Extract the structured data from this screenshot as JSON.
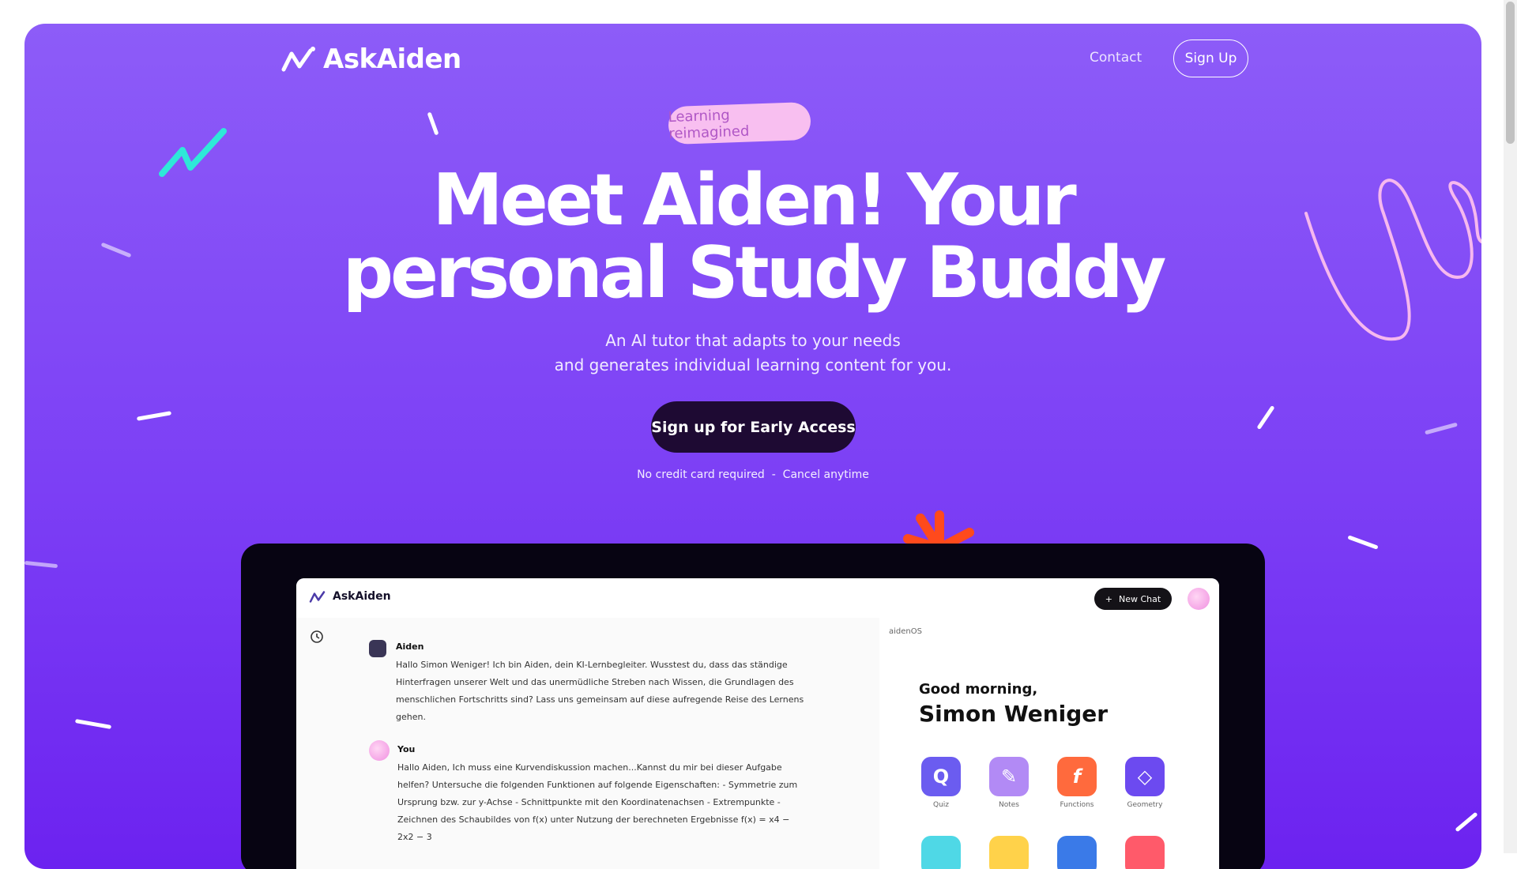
{
  "brand": {
    "name": "AskAiden"
  },
  "nav": {
    "contact": "Contact",
    "signup": "Sign Up"
  },
  "hero": {
    "badge": "Learning reimagined",
    "headline_line1": "Meet Aiden! Your",
    "headline_line2": "personal Study Buddy",
    "subtitle_line1": "An AI tutor that adapts to your needs",
    "subtitle_line2": "and generates individual learning content for you.",
    "cta": "Sign up for Early Access",
    "note": "No credit card required  -  Cancel anytime"
  },
  "app": {
    "brand": "AskAiden",
    "new_chat": "New Chat",
    "messages": [
      {
        "sender": "Aiden",
        "text": "Hallo Simon Weniger! Ich bin Aiden, dein KI-Lernbegleiter. Wusstest du, dass das ständige Hinterfragen unserer Welt und das unermüdliche Streben nach Wissen, die Grundlagen des menschlichen Fortschritts sind? Lass uns gemeinsam auf diese aufregende Reise des Lernens gehen."
      },
      {
        "sender": "You",
        "text": "Hallo Aiden, Ich muss eine Kurvendiskussion machen...Kannst du mir bei dieser Aufgabe helfen? Untersuche die folgenden Funktionen auf folgende Eigenschaften: - Symmetrie zum Ursprung bzw. zur y-Achse - Schnittpunkte mit den Koordinatenachsen - Extrempunkte - Zeichnen des Schaubildes von f(x) unter Nutzung der berechneten Ergebnisse f(x) = x4 − 2x2 − 3"
      }
    ],
    "panel": {
      "label": "aidenOS",
      "greeting": "Good morning,",
      "user": "Simon Weniger",
      "tiles": [
        {
          "label": "Quiz",
          "color": "#6b5cf0"
        },
        {
          "label": "Notes",
          "color": "#b28af5"
        },
        {
          "label": "Functions",
          "color": "#ff6a3d"
        },
        {
          "label": "Geometry",
          "color": "#6c4af0"
        }
      ]
    }
  }
}
